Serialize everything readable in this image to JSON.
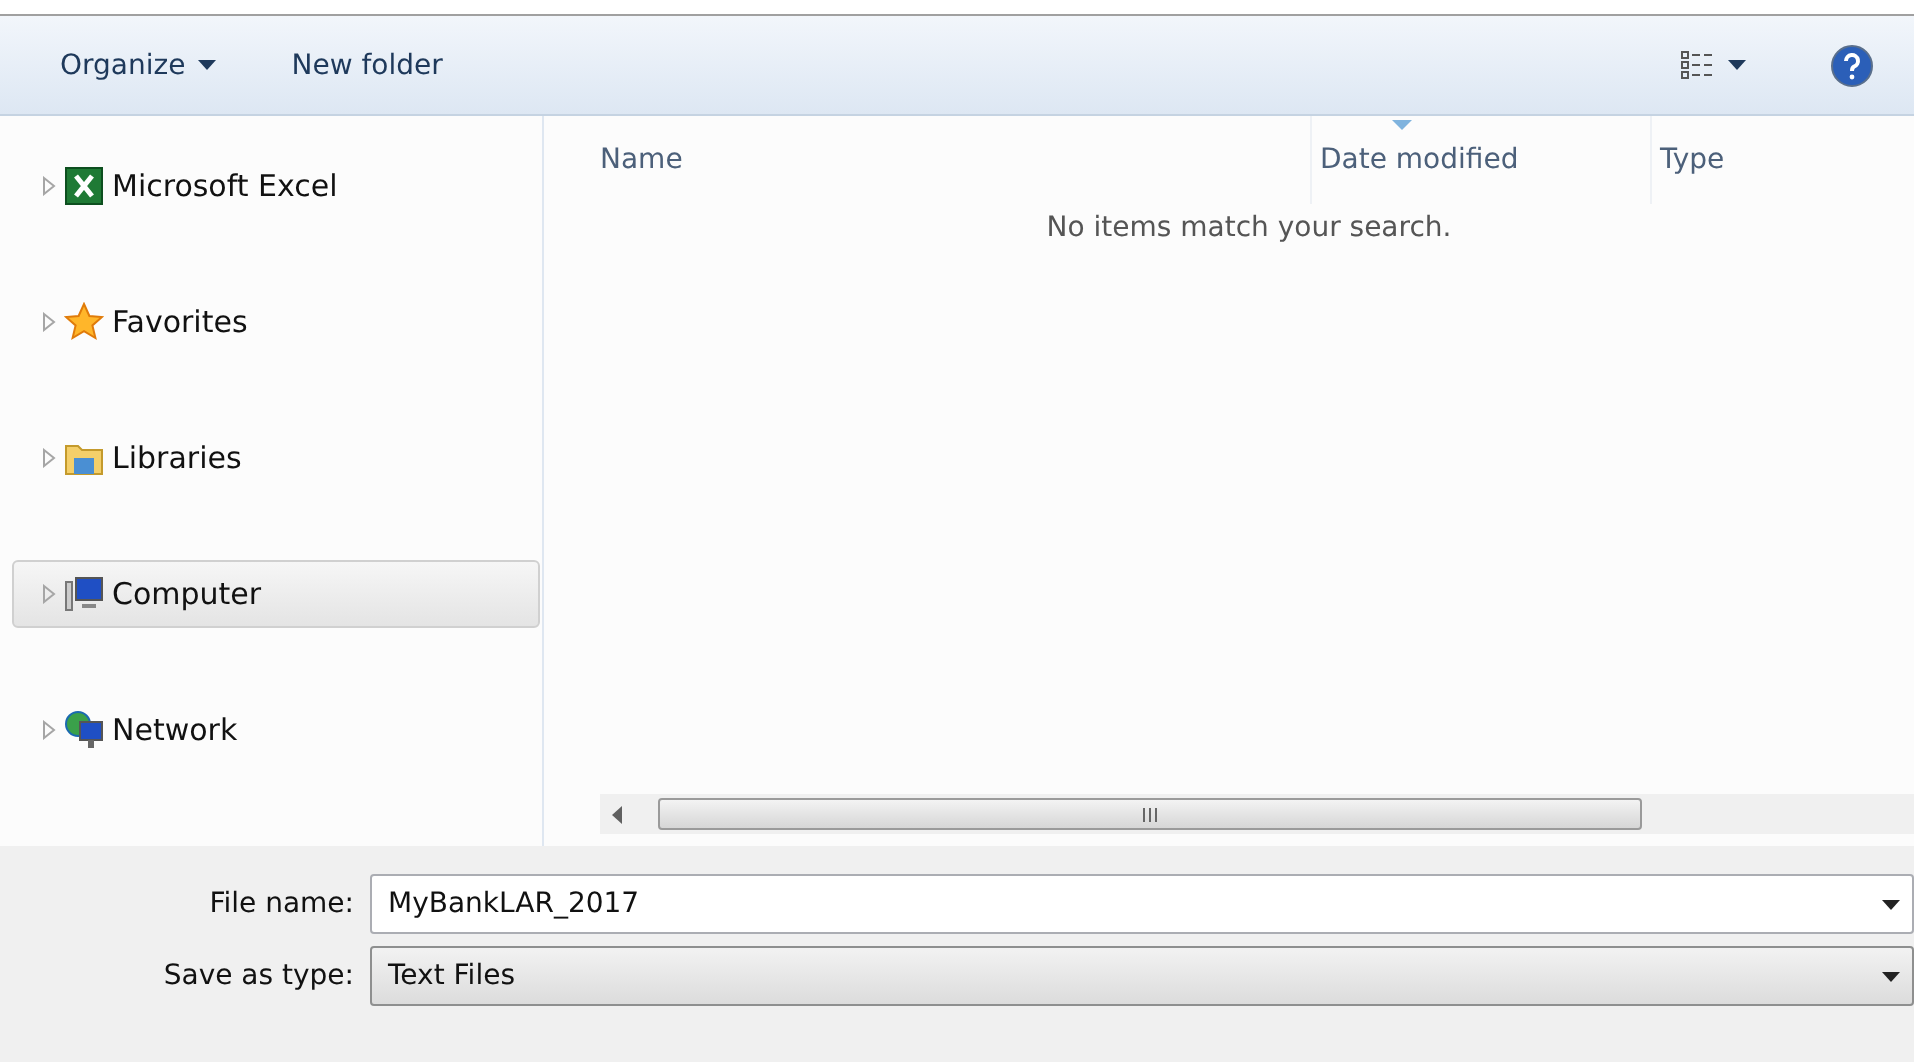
{
  "toolbar": {
    "organize": "Organize",
    "new_folder": "New folder"
  },
  "sidebar": {
    "items": [
      {
        "kind": "excel",
        "label": "Microsoft Excel",
        "selected": false
      },
      {
        "kind": "star",
        "label": "Favorites",
        "selected": false
      },
      {
        "kind": "library",
        "label": "Libraries",
        "selected": false
      },
      {
        "kind": "computer",
        "label": "Computer",
        "selected": true
      },
      {
        "kind": "network",
        "label": "Network",
        "selected": false
      }
    ]
  },
  "list": {
    "columns": [
      {
        "label": "Name",
        "sorted": false
      },
      {
        "label": "Date modified",
        "sorted": true
      },
      {
        "label": "Type",
        "sorted": false
      }
    ],
    "empty_message": "No items match your search."
  },
  "form": {
    "file_name": {
      "label": "File name:",
      "value": "MyBankLAR_2017"
    },
    "save_as_type": {
      "label": "Save as type:",
      "value": "Text Files"
    }
  }
}
